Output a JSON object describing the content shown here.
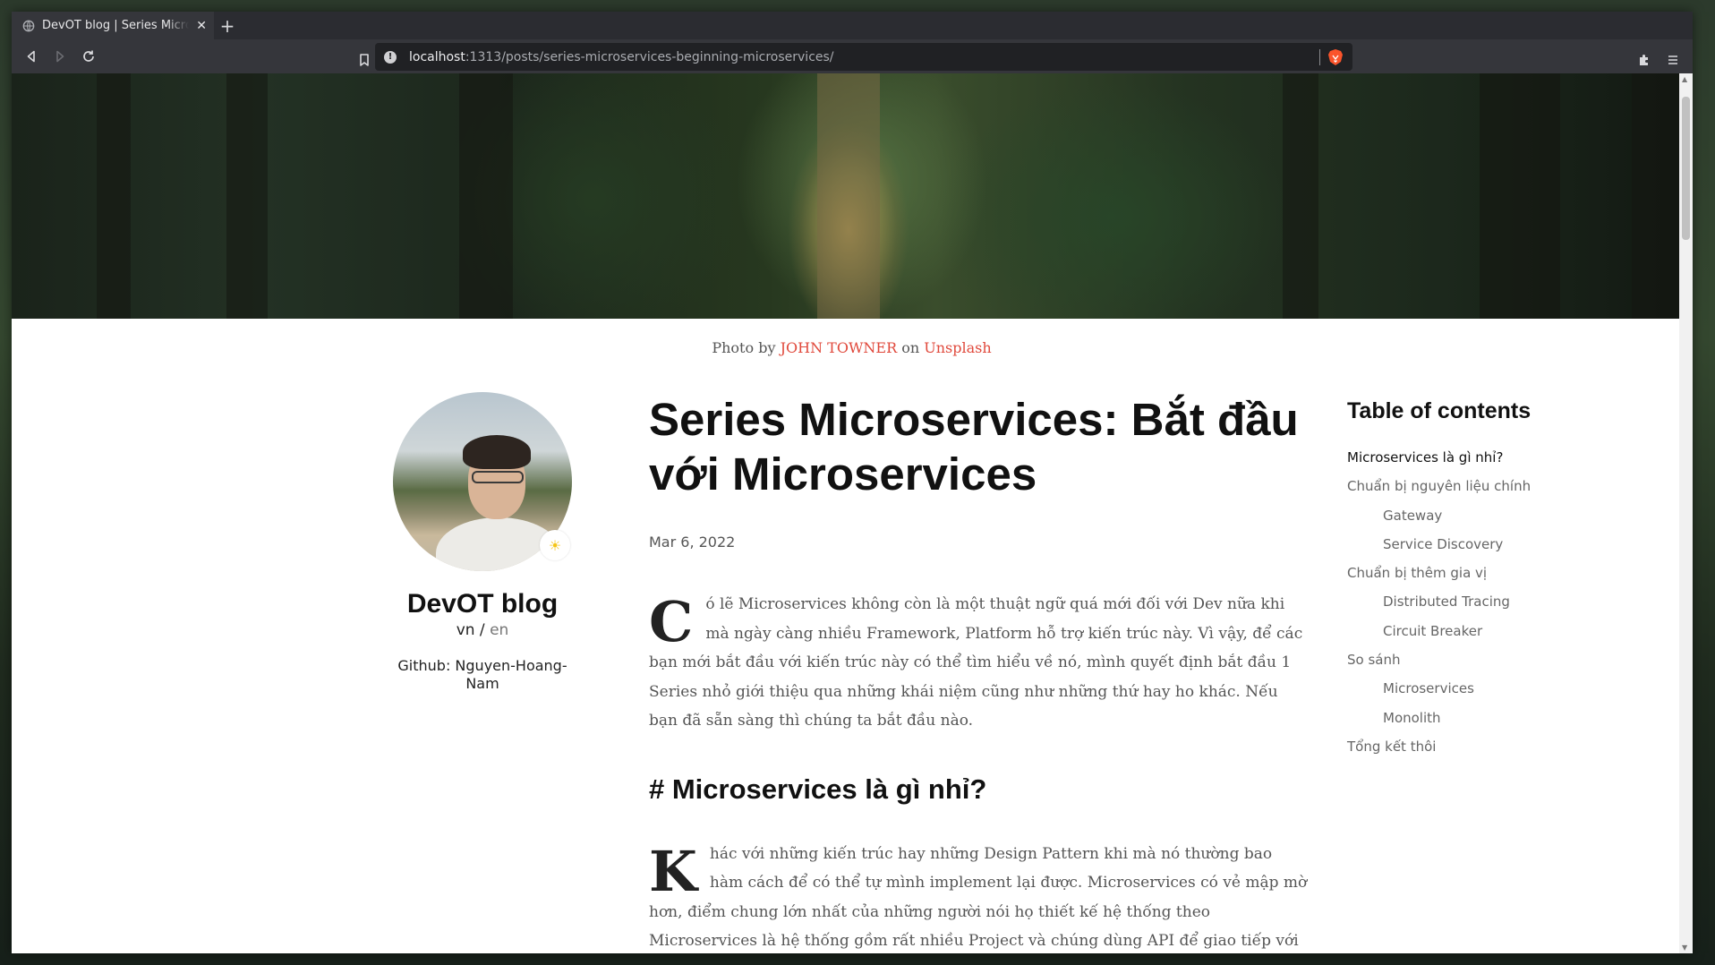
{
  "browser": {
    "tab_title": "DevOT blog | Series Microservices: Bắt đầu với Microservices",
    "new_tab": "+",
    "url_host": "localhost",
    "url_path": ":1313/posts/series-microservices-beginning-microservices/"
  },
  "hero": {
    "caption_prefix": "Photo by",
    "photographer": "JOHN TOWNER",
    "caption_mid": "on",
    "source": "Unsplash"
  },
  "profile": {
    "blog_name": "DevOT blog",
    "lang_vn": "vn",
    "lang_sep": " / ",
    "lang_en": "en",
    "github": "Github: Nguyen-Hoang-Nam"
  },
  "article": {
    "title": "Series Microservices: Bắt đầu với Microservices",
    "date": "Mar 6, 2022",
    "intro_drop": "C",
    "intro_text": "ó lẽ Microservices không còn là một thuật ngữ quá mới đối với Dev nữa khi mà ngày càng nhiều Framework, Platform hỗ trợ kiến trúc này. Vì vậy, để các bạn mới bắt đầu với kiến trúc này có thể tìm hiểu về nó, mình quyết định bắt đầu 1 Series nhỏ giới thiệu qua những khái niệm cũng như những thứ hay ho khác. Nếu bạn đã sẵn sàng thì chúng ta bắt đầu nào.",
    "section1_heading": "# Microservices là gì nhỉ?",
    "section1_drop": "K",
    "section1_text": "hác với những kiến trúc hay những Design Pattern khi mà nó thường bao hàm cách để có thể tự mình implement lại được. Microservices có vẻ mập mờ hơn, điểm chung lớn nhất của những người nói họ thiết kế hệ thống theo Microservices là hệ thống gồm rất nhiều Project và chúng dùng API để giao tiếp với nhau."
  },
  "toc": {
    "title": "Table of contents",
    "items": [
      {
        "label": "Microservices là gì nhỉ?",
        "level": 1,
        "active": true
      },
      {
        "label": "Chuẩn bị nguyên liệu chính",
        "level": 1
      },
      {
        "label": "Gateway",
        "level": 2
      },
      {
        "label": "Service Discovery",
        "level": 2
      },
      {
        "label": "Chuẩn bị thêm gia vị",
        "level": 1
      },
      {
        "label": "Distributed Tracing",
        "level": 2
      },
      {
        "label": "Circuit Breaker",
        "level": 2
      },
      {
        "label": "So sánh",
        "level": 1
      },
      {
        "label": "Microservices",
        "level": 2
      },
      {
        "label": "Monolith",
        "level": 2
      },
      {
        "label": "Tổng kết thôi",
        "level": 1
      }
    ]
  },
  "colors": {
    "link": "#e0483b",
    "browser_chrome": "#35363b",
    "urlbar_bg": "#202124"
  },
  "icons": {
    "tab": "globe-icon",
    "close": "close-icon",
    "back": "back-arrow-icon",
    "forward": "forward-arrow-icon",
    "reload": "reload-icon",
    "bookmark": "bookmark-icon",
    "site_info": "info-icon",
    "shields": "brave-lion-icon",
    "extensions": "puzzle-icon",
    "menu": "hamburger-menu-icon",
    "theme": "sun-icon"
  }
}
